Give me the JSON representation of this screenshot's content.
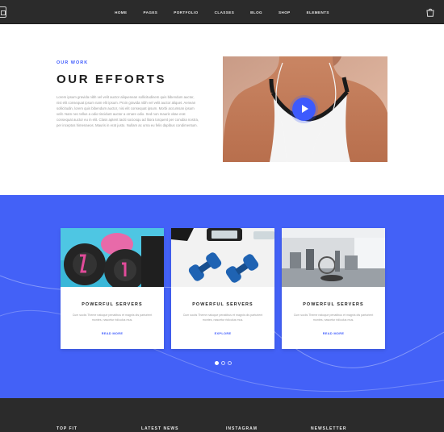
{
  "nav": {
    "items": [
      "HOME",
      "PAGES",
      "PORTFOLIO",
      "CLASSES",
      "BLOG",
      "SHOP",
      "ELEMENTS"
    ]
  },
  "about": {
    "eyebrow": "OUR WORK",
    "title": "OUR EFFORTS",
    "body": "Lorem ipsum gravida nibh vel velit auctor aliquenean sollicitudinem quis bibendum auctor, nisi elit consequat ipsum nam elit ipsum. Proin gravida nibh vel velit auctor aliquet. Aenean sollicitudin, lorem quis bibendum auctor, nisi elit consequat ipsum. Morbi accumsan ipsum velit. Nam nec tellus a odio tincidunt auctor a ornare odio. Sed non mauris vitae erat consequat auctor eu in elit. Class aptent taciti sociosqu ad litora torquent per conubia nostra, per inceptos himenaeos. Mauris in erat justo. Nullam ac urna eu felis dapibus condimentum."
  },
  "features": [
    {
      "title": "POWERFUL SERVERS",
      "text": "Cum sociis Theme natoque penatibus et magnis dis parturient montes, nascetur ridiculus mus.",
      "link": "READ MORE"
    },
    {
      "title": "POWERFUL SERVERS",
      "text": "Cum sociis Theme natoque penatibus et magnis dis parturient montes, nascetur ridiculus mus.",
      "link": "EXPLORE"
    },
    {
      "title": "POWERFUL SERVERS",
      "text": "Cum sociis Theme natoque penatibus et magnis dis parturient montes, nascetur ridiculus mus.",
      "link": "READ MORE"
    }
  ],
  "slider": {
    "active_dot": 1,
    "dot_count": 3
  },
  "footer": {
    "columns": [
      "TOP FIT",
      "LATEST NEWS",
      "INSTAGRAM",
      "NEWSLETTER"
    ]
  },
  "colors": {
    "accent": "#3d5afe",
    "band": "#4361f7",
    "dark": "#2b2b2b"
  },
  "icons": [
    "logo-icon",
    "cart-icon",
    "play-icon"
  ]
}
